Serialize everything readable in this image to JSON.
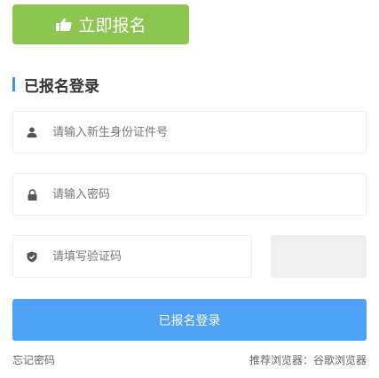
{
  "register_button": {
    "label": "立即报名",
    "icon": "thumbs-up-icon",
    "color": "#8cc54f"
  },
  "login_section": {
    "title": "已报名登录",
    "accent": "#4a90e2"
  },
  "fields": {
    "id_number": {
      "placeholder": "请输入新生身份证件号",
      "icon": "user-icon"
    },
    "password": {
      "placeholder": "请输入密码",
      "icon": "lock-icon"
    },
    "captcha": {
      "placeholder": "请填写验证码",
      "icon": "shield-icon"
    }
  },
  "login_button": {
    "label": "已报名登录",
    "color": "#4fa0f7"
  },
  "footer": {
    "forgot_password": "忘记密码",
    "browser_note": "推荐浏览器：谷歌浏览器"
  }
}
